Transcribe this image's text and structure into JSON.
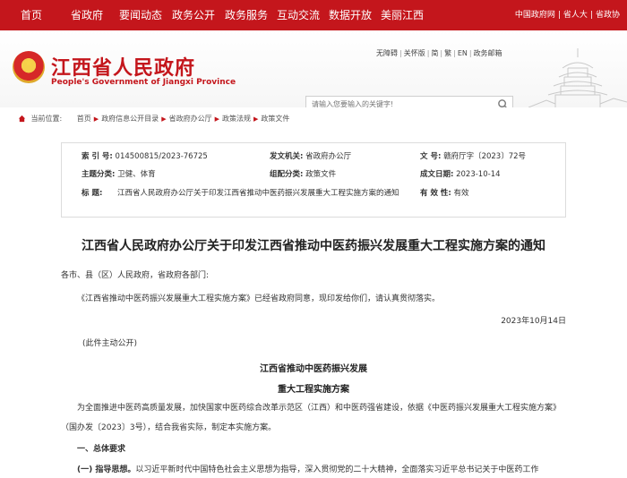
{
  "topnav": {
    "items": [
      "首页",
      "省政府",
      "要闻动态",
      "政务公开",
      "政务服务",
      "互动交流",
      "数据开放",
      "美丽江西"
    ],
    "right": [
      "中国政府网",
      "省人大",
      "省政协"
    ]
  },
  "header": {
    "title": "江西省人民政府",
    "subtitle": "People's Government of Jiangxi Province",
    "links": [
      "无障碍",
      "关怀版",
      "简",
      "繁",
      "EN",
      "政务邮箱"
    ],
    "search_placeholder": "请输入您要输入的关键字!"
  },
  "breadcrumb": {
    "label": "当前位置:",
    "items": [
      "首页",
      "政府信息公开目录",
      "省政府办公厅",
      "政策法规",
      "政策文件"
    ]
  },
  "info": {
    "index_label": "索 引 号:",
    "index_value": "014500815/2023-76725",
    "issuer_label": "发文机关:",
    "issuer_value": "省政府办公厅",
    "docno_label": "文 号:",
    "docno_value": "赣府厅字〔2023〕72号",
    "topic_label": "主题分类:",
    "topic_value": "卫健、体育",
    "genre_label": "组配分类:",
    "genre_value": "政策文件",
    "date_label": "成文日期:",
    "date_value": "2023-10-14",
    "title_label": "标 题:",
    "title_value": "江西省人民政府办公厅关于印发江西省推动中医药振兴发展重大工程实施方案的通知",
    "validity_label": "有 效 性:",
    "validity_value": "有效"
  },
  "document": {
    "title": "江西省人民政府办公厅关于印发江西省推动中医药振兴发展重大工程实施方案的通知",
    "salutation": "各市、县（区）人民政府，省政府各部门:",
    "body1": "《江西省推动中医药振兴发展重大工程实施方案》已经省政府同意，现印发给你们，请认真贯彻落实。",
    "date": "2023年10月14日",
    "note": "(此件主动公开)",
    "plan_title_1": "江西省推动中医药振兴发展",
    "plan_title_2": "重大工程实施方案",
    "intro": "为全面推进中医药高质量发展，加快国家中医药综合改革示范区（江西）和中医药强省建设，依据《中医药振兴发展重大工程实施方案》（国办发〔2023〕3号），结合我省实际，制定本实施方案。",
    "section1": "一、总体要求",
    "sub1_label": "(一) 指导思想。",
    "sub1_text": "以习近平新时代中国特色社会主义思想为指导，深入贯彻党的二十大精神，全面落实习近平总书记关于中医药工作"
  }
}
